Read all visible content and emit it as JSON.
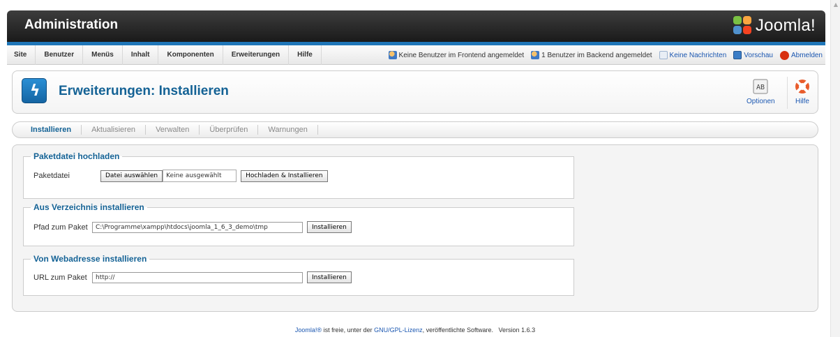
{
  "header": {
    "title": "Administration",
    "logo_text": "Joomla!"
  },
  "menu": {
    "items": [
      "Site",
      "Benutzer",
      "Menüs",
      "Inhalt",
      "Komponenten",
      "Erweiterungen",
      "Hilfe"
    ]
  },
  "status": {
    "frontend": "Keine Benutzer im Frontend angemeldet",
    "backend": "1 Benutzer im Backend angemeldet",
    "messages": "Keine Nachrichten",
    "preview": "Vorschau",
    "logout": "Abmelden"
  },
  "toolbar": {
    "page_title": "Erweiterungen: Installieren",
    "options_label": "Optionen",
    "help_label": "Hilfe"
  },
  "tabs": [
    "Installieren",
    "Aktualisieren",
    "Verwalten",
    "Überprüfen",
    "Warnungen"
  ],
  "upload": {
    "legend": "Paketdatei hochladen",
    "label": "Paketdatei",
    "choose_button": "Datei auswählen",
    "no_file": "Keine ausgewählt",
    "install_button": "Hochladen & Installieren"
  },
  "directory": {
    "legend": "Aus Verzeichnis installieren",
    "label": "Pfad zum Paket",
    "value": "C:\\Programme\\xampp\\htdocs\\joomla_1_6_3_demo\\tmp",
    "install_button": "Installieren"
  },
  "url": {
    "legend": "Von Webadresse installieren",
    "label": "URL zum Paket",
    "value": "http://",
    "install_button": "Installieren"
  },
  "footer": {
    "joomla_link": "Joomla!®",
    "text1": " ist freie, unter der ",
    "license_link": "GNU/GPL-Lizenz",
    "text2": ", veröffentlichte Software.",
    "version": "Version 1.6.3"
  }
}
